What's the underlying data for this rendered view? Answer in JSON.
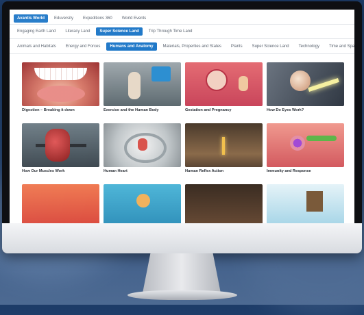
{
  "nav_primary": [
    {
      "label": "Avantis World",
      "active": true
    },
    {
      "label": "Eduversity",
      "active": false
    },
    {
      "label": "Expeditions 360",
      "active": false
    },
    {
      "label": "World Events",
      "active": false
    }
  ],
  "nav_secondary": [
    {
      "label": "Engaging Earth Land",
      "active": false
    },
    {
      "label": "Literacy Land",
      "active": false
    },
    {
      "label": "Super Science Land",
      "active": true
    },
    {
      "label": "Trip Through Time Land",
      "active": false
    }
  ],
  "nav_categories": [
    {
      "label": "Animals and Habitats",
      "active": false
    },
    {
      "label": "Energy and Forces",
      "active": false
    },
    {
      "label": "Humans and Anatomy",
      "active": true
    },
    {
      "label": "Materials, Properties and States",
      "active": false
    },
    {
      "label": "Plants",
      "active": false
    },
    {
      "label": "Super Science Land",
      "active": false
    },
    {
      "label": "Technology",
      "active": false
    },
    {
      "label": "Time and Space",
      "active": false
    }
  ],
  "cards": [
    {
      "title": "Digestion – Breaking it down",
      "thumb": "t-digest"
    },
    {
      "title": "Exercise and the Human Body",
      "thumb": "t-exercise"
    },
    {
      "title": "Gestation and Pregnancy",
      "thumb": "t-gest"
    },
    {
      "title": "How Do Eyes Work?",
      "thumb": "t-eyes"
    },
    {
      "title": "How Our Muscles Work",
      "thumb": "t-muscle"
    },
    {
      "title": "Human Heart",
      "thumb": "t-heart"
    },
    {
      "title": "Human Reflex Action",
      "thumb": "t-reflex"
    },
    {
      "title": "Immunity and Response",
      "thumb": "t-immun"
    },
    {
      "title": "",
      "thumb": "t-r3a"
    },
    {
      "title": "",
      "thumb": "t-r3b"
    },
    {
      "title": "",
      "thumb": "t-r3c"
    },
    {
      "title": "",
      "thumb": "t-r3d"
    }
  ],
  "colors": {
    "accent": "#1f78c8",
    "background": "#274a7a"
  }
}
